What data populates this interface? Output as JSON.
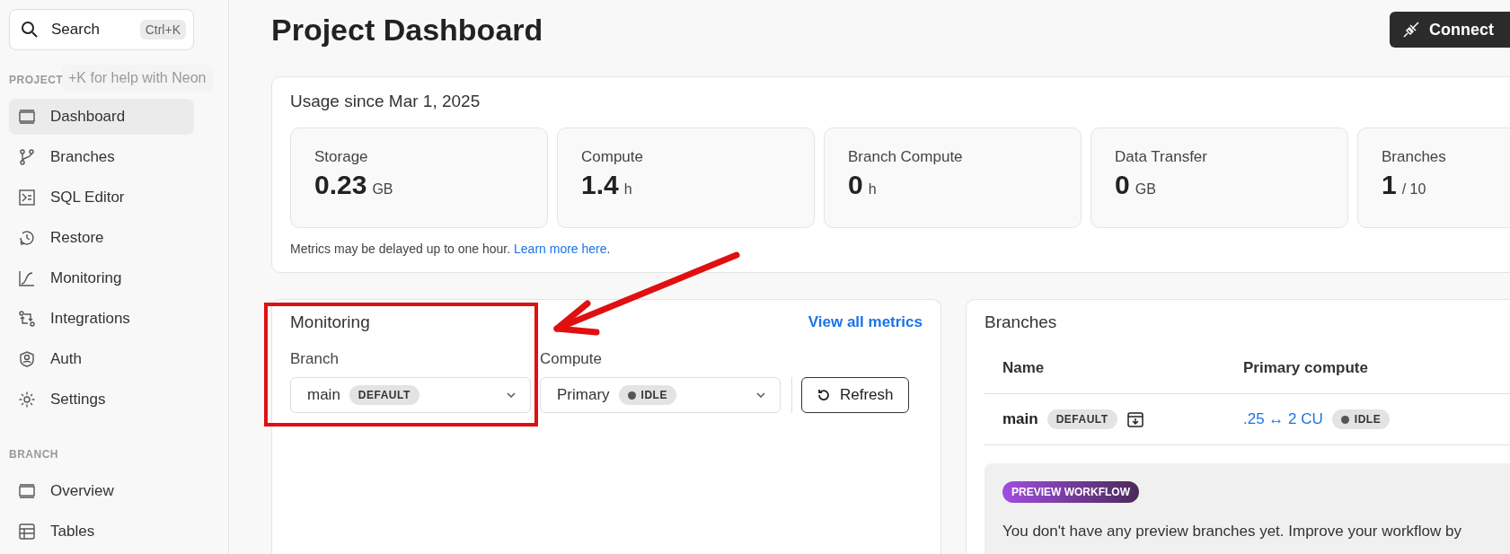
{
  "sidebar": {
    "search": {
      "label": "Search",
      "shortcut": "Ctrl+K"
    },
    "tooltip": "+K for help with Neon",
    "sections": [
      {
        "title": "PROJECT",
        "items": [
          {
            "label": "Dashboard",
            "selected": true
          },
          {
            "label": "Branches",
            "selected": false
          },
          {
            "label": "SQL Editor",
            "selected": false
          },
          {
            "label": "Restore",
            "selected": false
          },
          {
            "label": "Monitoring",
            "selected": false
          },
          {
            "label": "Integrations",
            "selected": false
          },
          {
            "label": "Auth",
            "selected": false
          },
          {
            "label": "Settings",
            "selected": false
          }
        ]
      },
      {
        "title": "BRANCH",
        "items": [
          {
            "label": "Overview",
            "selected": false
          },
          {
            "label": "Tables",
            "selected": false
          }
        ]
      }
    ]
  },
  "header": {
    "title": "Project Dashboard",
    "connect_button": "Connect"
  },
  "usage": {
    "title": "Usage since Mar 1, 2025",
    "stats": [
      {
        "label": "Storage",
        "value": "0.23",
        "unit": "GB"
      },
      {
        "label": "Compute",
        "value": "1.4",
        "unit": "h"
      },
      {
        "label": "Branch Compute",
        "value": "0",
        "unit": "h"
      },
      {
        "label": "Data Transfer",
        "value": "0",
        "unit": "GB"
      },
      {
        "label": "Branches",
        "value": "1",
        "unit": "/ 10"
      }
    ],
    "note": "Metrics may be delayed up to one hour.",
    "note_link": "Learn more here",
    "note_end": "."
  },
  "monitoring": {
    "title": "Monitoring",
    "link": "View all metrics",
    "branch_label": "Branch",
    "branch_value": "main",
    "branch_badge": "DEFAULT",
    "compute_label": "Compute",
    "compute_value": "Primary",
    "compute_badge": "IDLE",
    "refresh_button": "Refresh"
  },
  "branches": {
    "title": "Branches",
    "columns": [
      "Name",
      "Primary compute"
    ],
    "rows": [
      {
        "name": "main",
        "badge": "DEFAULT",
        "compute": ".25 ↔ 2 CU",
        "status": "IDLE"
      }
    ],
    "preview": {
      "tag": "PREVIEW WORKFLOW",
      "text": "You don't have any preview branches yet. Improve your workflow by"
    }
  }
}
